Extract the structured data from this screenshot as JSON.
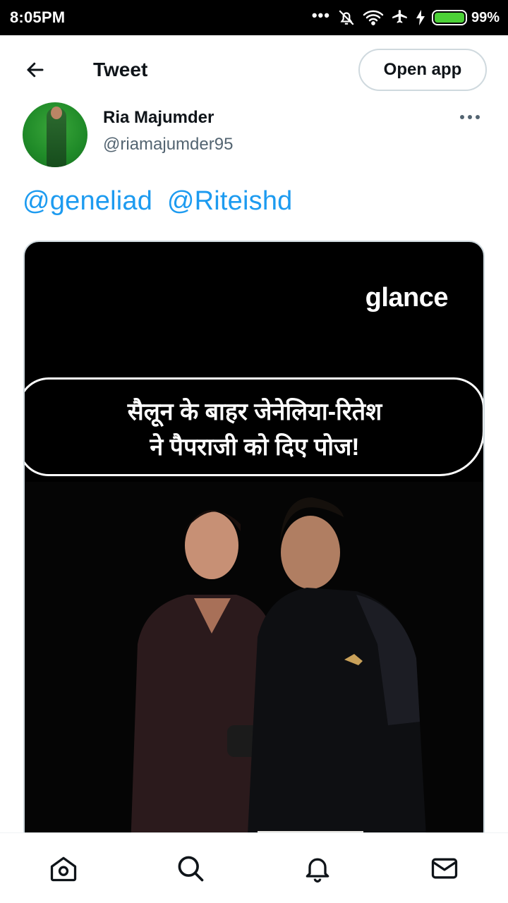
{
  "status_bar": {
    "time": "8:05PM",
    "dots": "•••",
    "battery": "99%",
    "battery_level": 0.99,
    "icons": [
      "mute-icon",
      "wifi-icon",
      "airplane-icon",
      "charging-icon",
      "battery-icon"
    ]
  },
  "header": {
    "title": "Tweet",
    "open_app_label": "Open app"
  },
  "tweet": {
    "author_name": "Ria Majumder",
    "author_handle": "@riamajumder95",
    "mentions": [
      "@geneliad",
      "@Riteishd"
    ],
    "media": {
      "brand": "glance",
      "headline_line1": "सैलून के बाहर जेनेलिया-रितेश",
      "headline_line2": "ने पैपराजी को दिए पोज!"
    }
  },
  "bottom_nav": {
    "items": [
      "home-icon",
      "search-icon",
      "notifications-icon",
      "messages-icon"
    ]
  },
  "colors": {
    "accent": "#1d9bf0",
    "text": "#0f1419",
    "muted": "#536471",
    "border": "#cfd9de",
    "battery_fill": "#4cd137"
  }
}
